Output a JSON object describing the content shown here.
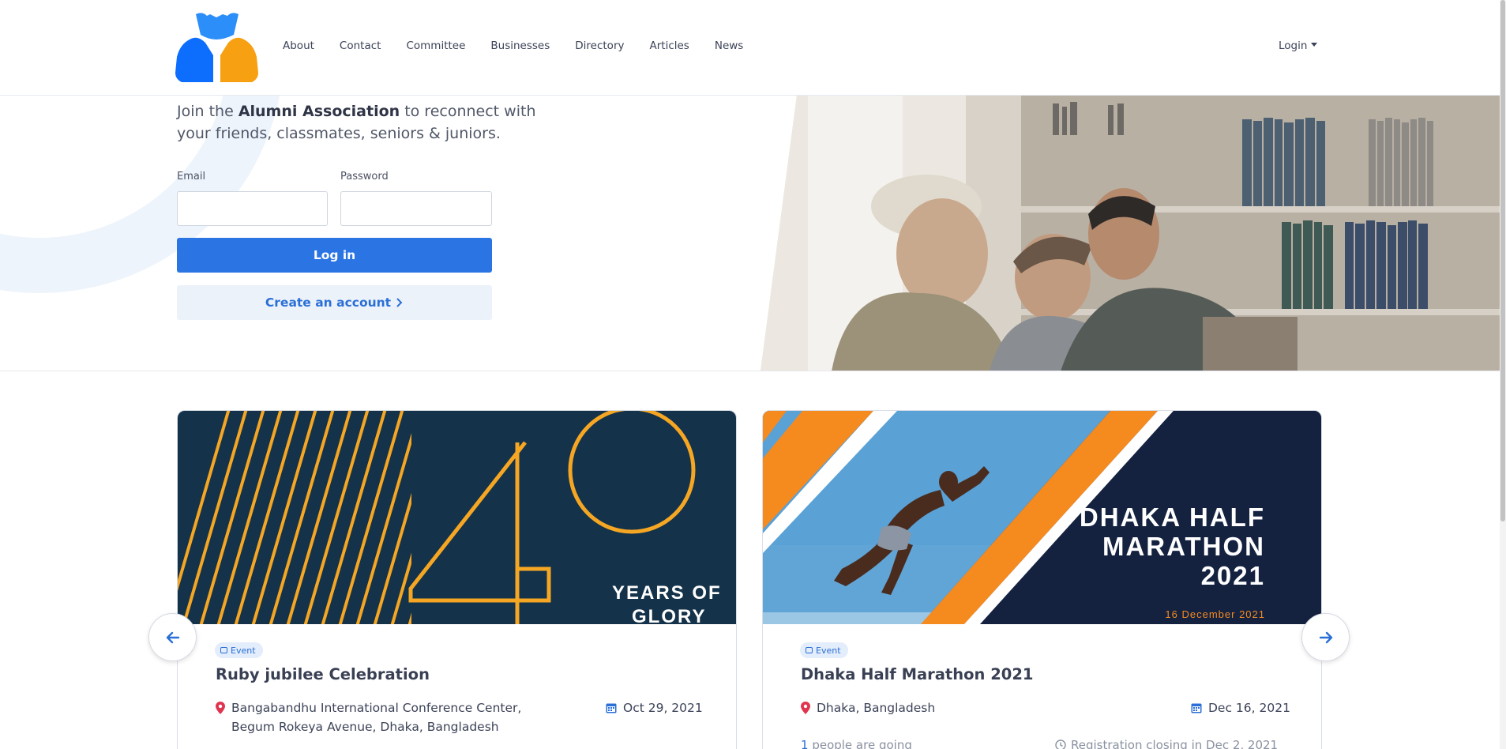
{
  "nav": {
    "links": [
      "About",
      "Contact",
      "Committee",
      "Businesses",
      "Directory",
      "Articles",
      "News"
    ],
    "login_label": "Login"
  },
  "hero": {
    "intro_prefix": "Join the ",
    "intro_bold": "Alumni Association",
    "intro_suffix": " to reconnect with your friends, classmates, seniors & juniors.",
    "email_label": "Email",
    "password_label": "Password",
    "email_value": "",
    "password_value": "",
    "login_button": "Log in",
    "create_account_button": "Create an account"
  },
  "events": [
    {
      "badge": "Event",
      "title": "Ruby jubilee Celebration",
      "location": "Bangabandhu International Conference Center, Begum Rokeya Avenue, Dhaka, Bangladesh",
      "date": "Oct 29, 2021",
      "image_text": [
        "YEARS OF",
        "GLORY"
      ]
    },
    {
      "badge": "Event",
      "title": "Dhaka Half Marathon 2021",
      "location": "Dhaka, Bangladesh",
      "date": "Dec 16, 2021",
      "image_text": [
        "DHAKA HALF",
        "MARATHON",
        "2021",
        "16 December 2021"
      ],
      "going_count": "1",
      "going_text": " people are going",
      "registration": "Registration closing in Dec 2, 2021"
    }
  ],
  "colors": {
    "primary": "#2a75e3",
    "logo_blue_light": "#2c8ef8",
    "logo_blue": "#0d6efd",
    "logo_orange": "#f7a012",
    "event1_bg": "#14324a",
    "event1_accent": "#f5a623",
    "event2_bg": "#142240",
    "event2_accent": "#f58a1f",
    "pin_red": "#e0344f"
  },
  "icons": [
    "logo-icon",
    "caret-down-icon",
    "chevron-right-icon",
    "ticket-icon",
    "map-pin-icon",
    "calendar-icon",
    "clock-icon",
    "arrow-left-icon",
    "arrow-right-icon"
  ]
}
